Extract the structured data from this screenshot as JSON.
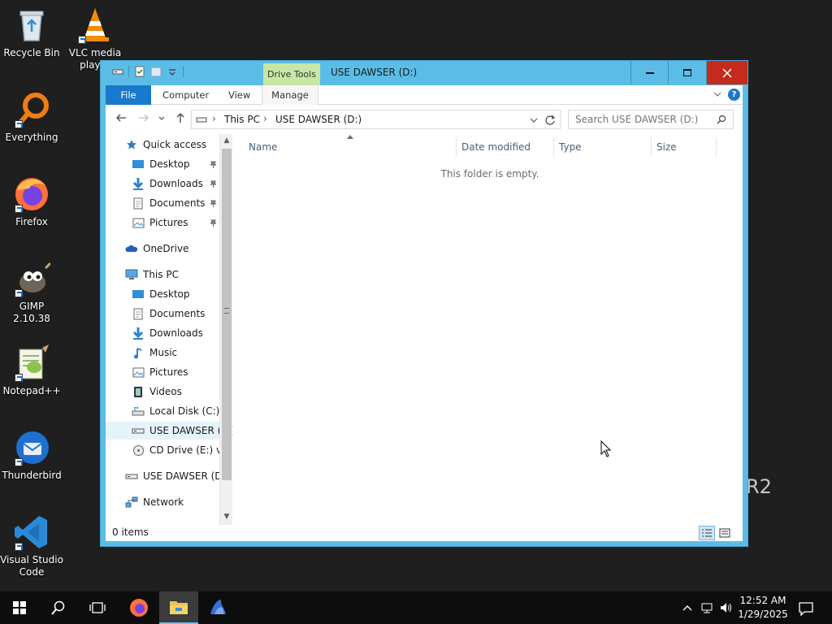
{
  "desktop": {
    "icons": [
      {
        "label": "Recycle Bin"
      },
      {
        "label": "VLC media player"
      },
      {
        "label": "Everything"
      },
      {
        "label": "Firefox"
      },
      {
        "label": "GIMP 2.10.38"
      },
      {
        "label": "Notepad++"
      },
      {
        "label": "Thunderbird"
      },
      {
        "label": "Visual Studio Code"
      }
    ],
    "server_text": "R2"
  },
  "window": {
    "title": "USE DAWSER (D:)",
    "contextual_tab": "Drive Tools",
    "ribbon_tabs": {
      "file": "File",
      "computer": "Computer",
      "view": "View",
      "manage": "Manage"
    },
    "help": "?"
  },
  "address": {
    "crumbs": [
      "This PC",
      "USE DAWSER (D:)"
    ],
    "search_placeholder": "Search USE DAWSER (D:)"
  },
  "navpane": {
    "quick_access": "Quick access",
    "quick_items": [
      "Desktop",
      "Downloads",
      "Documents",
      "Pictures"
    ],
    "onedrive": "OneDrive",
    "this_pc": "This PC",
    "pc_items": [
      "Desktop",
      "Documents",
      "Downloads",
      "Music",
      "Pictures",
      "Videos",
      "Local Disk (C:)",
      "USE DAWSER (D:)",
      "CD Drive (E:) virt"
    ],
    "drive": "USE DAWSER (D:)",
    "network": "Network"
  },
  "filelist": {
    "columns": [
      "Name",
      "Date modified",
      "Type",
      "Size"
    ],
    "empty_message": "This folder is empty."
  },
  "status": {
    "items": "0 items"
  },
  "taskbar": {
    "time": "12:52 AM",
    "date": "1/29/2025"
  },
  "colors": {
    "title_bg": "#5bbde6",
    "file_tab": "#1979ca",
    "drive_tools": "#c7e7a4",
    "close": "#c42b1c"
  }
}
